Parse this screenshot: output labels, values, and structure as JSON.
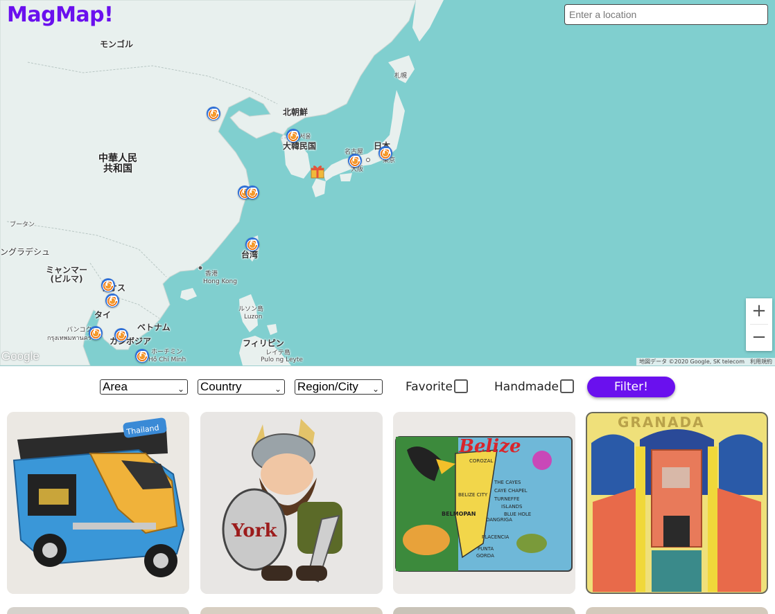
{
  "app": {
    "title": "MagMap!"
  },
  "search": {
    "placeholder": "Enter a location"
  },
  "map": {
    "labels": {
      "mongolia": "モンゴル",
      "north_korea": "北朝鮮",
      "south_korea": "大韓民国",
      "china_line1": "中華人民",
      "china_line2": "共和国",
      "japan": "日本",
      "sapporo": "札幌",
      "nagoya": "名古屋",
      "osaka": "大阪",
      "tokyo": "東京",
      "seoul": "서울",
      "bhutan": "ブータン",
      "bangladesh": "ングラデシュ",
      "myanmar_line1": "ミャンマー",
      "myanmar_line2": "(ビルマ)",
      "laos": "ラオス",
      "thailand": "タイ",
      "vietnam": "ベトナム",
      "cambodia": "カンボジア",
      "bangkok": "バンコク",
      "bangkok_thai": "กรุงเทพมหานคร",
      "hcmc_jp": "ホーチミン",
      "hcmc": "Hồ Chí Minh",
      "hongkong_jp": "香港",
      "hongkong": "Hong Kong",
      "taiwan": "台湾",
      "luzon_jp": "ルソン島",
      "luzon": "Luzon",
      "philippines": "フィリピン",
      "leyte_jp": "レイテ島",
      "leyte": "Pulo ng Leyte"
    },
    "zoom_in": "+",
    "zoom_out": "−",
    "logo": "Google",
    "attribution": "地図データ ©2020 Google, SK telecom",
    "terms": "利用規約",
    "colors": {
      "water": "#7fcfcf",
      "land": "#e8f0ee",
      "brand": "#6a10ee"
    }
  },
  "filters": {
    "area": "Area",
    "country": "Country",
    "region": "Region/City",
    "favorite_label": "Favorite",
    "favorite_checked": false,
    "handmade_label": "Handmade",
    "handmade_checked": false,
    "submit": "Filter!"
  },
  "gallery": {
    "items": [
      {
        "image": "tuk-tuk magnet",
        "text": "Thailand"
      },
      {
        "image": "viking magnet",
        "text": "York"
      },
      {
        "image": "belize map magnet",
        "text": "Belize"
      },
      {
        "image": "alhambra tile magnet",
        "text": "GRANADA"
      }
    ]
  },
  "belize_map_text": {
    "corozal": "COROZAL",
    "belize_city": "BELIZE CITY",
    "belmopan": "BELMOPAN",
    "the_cayes": "THE CAYES",
    "caye_chapel": "CAYE CHAPEL",
    "turneffe": "TURNEFFE",
    "islands": "ISLANDS",
    "blue_hole": "BLUE HOLE",
    "dangriga": "DANGRIGA",
    "placencia": "PLACENCIA",
    "punta": "PUNTA",
    "gorda": "GORDA"
  }
}
